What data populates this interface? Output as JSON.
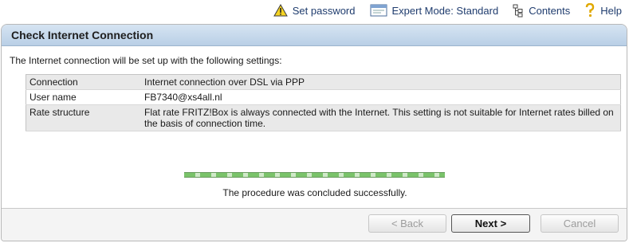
{
  "topbar": {
    "set_password": "Set password",
    "expert_mode": "Expert Mode: Standard",
    "contents": "Contents",
    "help": "Help"
  },
  "panel": {
    "title": "Check Internet Connection",
    "intro": "The Internet connection will be set up with the following settings:",
    "settings": [
      {
        "label": "Connection",
        "value": "Internet connection over DSL via PPP"
      },
      {
        "label": "User name",
        "value": "FB7340@xs4all.nl"
      },
      {
        "label": "Rate structure",
        "value": "Flat rate FRITZ!Box is always connected with the Internet. This setting is not suitable for Internet rates billed on the basis of connection time."
      }
    ],
    "progress_fraction": 1.0,
    "status": "The procedure was concluded successfully."
  },
  "buttons": {
    "back": "< Back",
    "next": "Next >",
    "cancel": "Cancel"
  },
  "icons": {
    "set_password": "warning-icon",
    "expert_mode": "window-icon",
    "contents": "sitemap-icon",
    "help": "question-icon"
  }
}
